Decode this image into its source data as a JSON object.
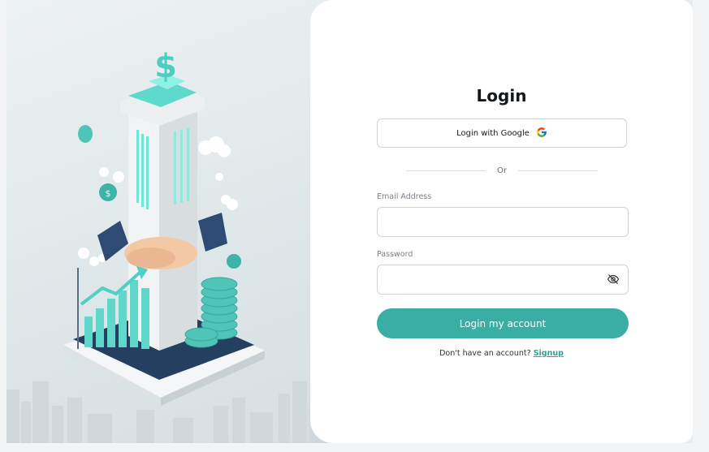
{
  "login": {
    "title": "Login",
    "google_button_label": "Login with Google",
    "divider_text": "Or",
    "email_label": "Email Address",
    "email_value": "",
    "password_label": "Password",
    "password_value": "",
    "submit_label": "Login my account",
    "signup_prompt": "Don't have an account?",
    "signup_link": "Signup"
  },
  "icons": {
    "google": "google-icon",
    "password_toggle": "eye-off-icon"
  },
  "colors": {
    "accent": "#3aaea4",
    "link": "#2fa196",
    "page_background": "#f3f4f5",
    "panel_background": "#ffffff"
  }
}
